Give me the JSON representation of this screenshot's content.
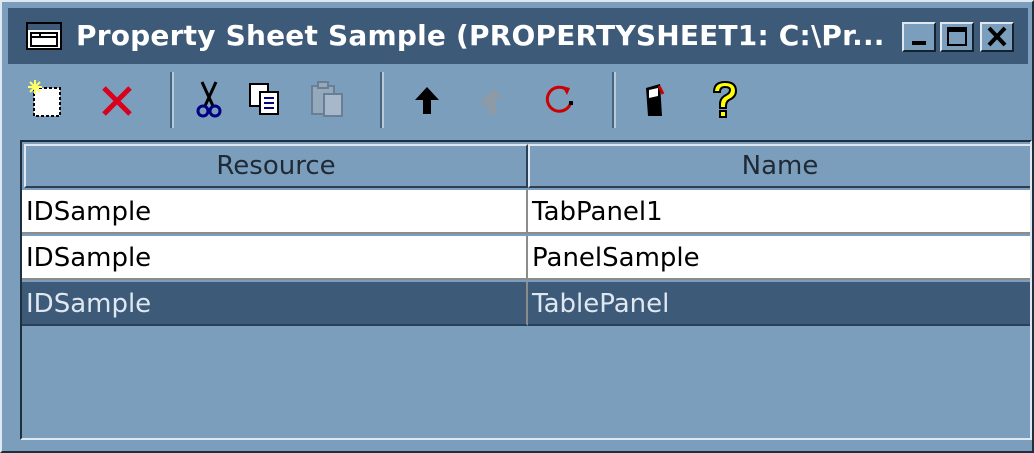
{
  "window": {
    "title": "Property Sheet Sample (PROPERTYSHEET1: C:\\Pr...",
    "controls": [
      "minimize-icon",
      "maximize-icon",
      "close-icon"
    ]
  },
  "toolbar": {
    "buttons": [
      {
        "icon": "new-icon",
        "enabled": true
      },
      {
        "icon": "delete-icon",
        "enabled": true
      },
      {
        "icon": "cut-icon",
        "enabled": true
      },
      {
        "icon": "copy-icon",
        "enabled": true
      },
      {
        "icon": "paste-icon",
        "enabled": false
      },
      {
        "icon": "move-up-icon",
        "enabled": true
      },
      {
        "icon": "move-down-icon",
        "enabled": false
      },
      {
        "icon": "refresh-icon",
        "enabled": true
      },
      {
        "icon": "properties-icon",
        "enabled": true
      },
      {
        "icon": "help-icon",
        "enabled": true
      }
    ]
  },
  "table": {
    "columns": [
      "Resource",
      "Name"
    ],
    "rows": [
      {
        "resource": "IDSample",
        "name": "TabPanel1",
        "selected": false
      },
      {
        "resource": "IDSample",
        "name": "PanelSample",
        "selected": false
      },
      {
        "resource": "IDSample",
        "name": "TablePanel",
        "selected": true
      }
    ]
  },
  "colors": {
    "window_bg": "#7b9ebd",
    "titlebar_bg": "#3d5a78",
    "selection_bg": "#3d5a78",
    "delete_red": "#d8001c",
    "help_yellow": "#ffff00"
  }
}
